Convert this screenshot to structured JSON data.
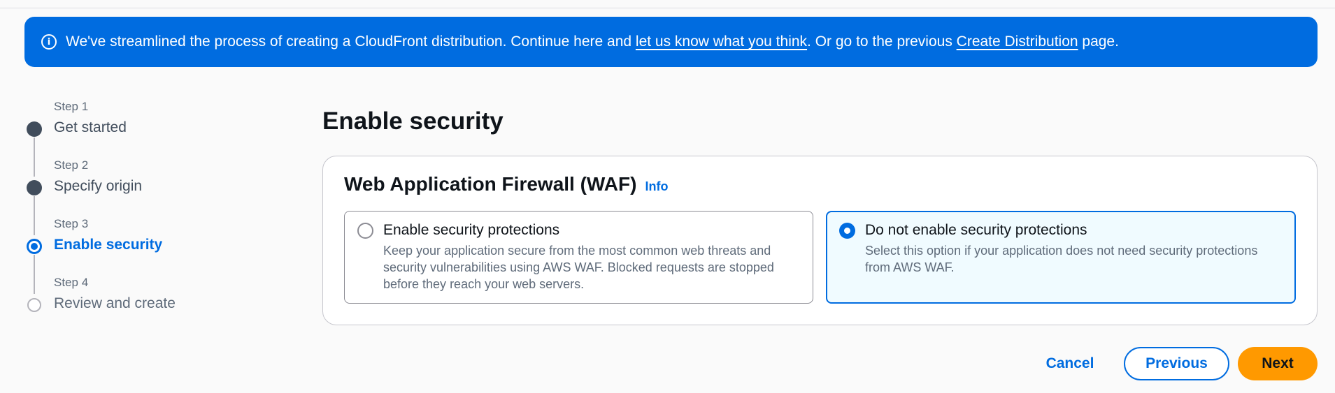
{
  "banner": {
    "text_before": "We've streamlined the process of creating a CloudFront distribution. Continue here and ",
    "feedback_link": "let us know what you think",
    "text_middle": ". Or go to the previous ",
    "create_link": "Create Distribution",
    "text_after": " page.",
    "icon": "info-circle-icon",
    "color": "#006ce0"
  },
  "steps": [
    {
      "caption": "Step 1",
      "label": "Get started",
      "state": "completed"
    },
    {
      "caption": "Step 2",
      "label": "Specify origin",
      "state": "completed"
    },
    {
      "caption": "Step 3",
      "label": "Enable security",
      "state": "active"
    },
    {
      "caption": "Step 4",
      "label": "Review and create",
      "state": "pending"
    }
  ],
  "page_title": "Enable security",
  "waf": {
    "title": "Web Application Firewall (WAF)",
    "info_label": "Info",
    "options": [
      {
        "title": "Enable security protections",
        "description": "Keep your application secure from the most common web threats and security vulnerabilities using AWS WAF. Blocked requests are stopped before they reach your web servers.",
        "selected": false
      },
      {
        "title": "Do not enable security protections",
        "description": "Select this option if your application does not need security protections from AWS WAF.",
        "selected": true
      }
    ]
  },
  "actions": {
    "cancel": "Cancel",
    "previous": "Previous",
    "next": "Next"
  },
  "colors": {
    "accent": "#006ce0",
    "primary_button": "#ff9900",
    "selected_tile_bg": "#f0fbff"
  }
}
